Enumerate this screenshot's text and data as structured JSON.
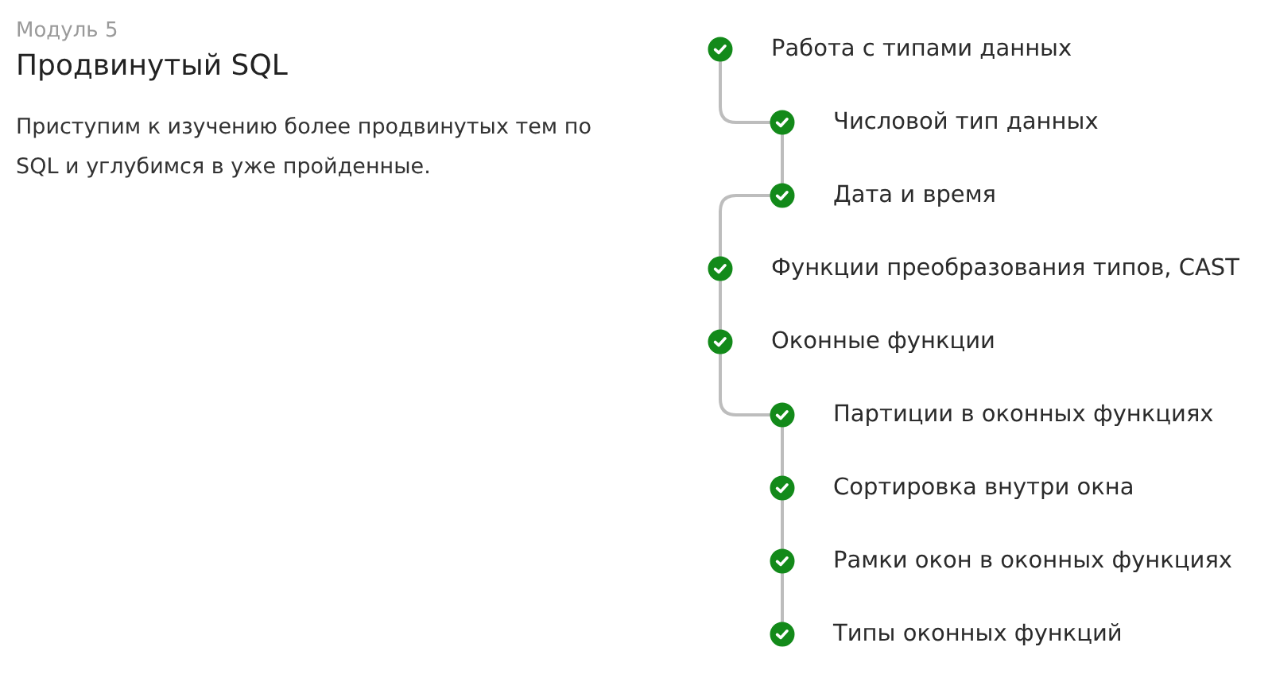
{
  "module": {
    "label": "Модуль 5",
    "title": "Продвинутый SQL",
    "description": "Приступим к изучению более продвинутых тем по SQL и углубимся в уже пройденные."
  },
  "lessons": [
    {
      "title": "Работа с типами данных",
      "kind": "main",
      "completed": true
    },
    {
      "title": "Числовой тип данных",
      "kind": "sub",
      "completed": true
    },
    {
      "title": "Дата и время",
      "kind": "sub",
      "completed": true
    },
    {
      "title": "Функции преобразования типов, CAST",
      "kind": "main",
      "completed": true
    },
    {
      "title": "Оконные функции",
      "kind": "main",
      "completed": true
    },
    {
      "title": "Партиции в оконных функциях",
      "kind": "sub",
      "completed": true
    },
    {
      "title": "Сортировка внутри окна",
      "kind": "sub",
      "completed": true
    },
    {
      "title": "Рамки окон в оконных функциях",
      "kind": "sub",
      "completed": true
    },
    {
      "title": "Типы оконных функций",
      "kind": "sub",
      "completed": true
    }
  ]
}
